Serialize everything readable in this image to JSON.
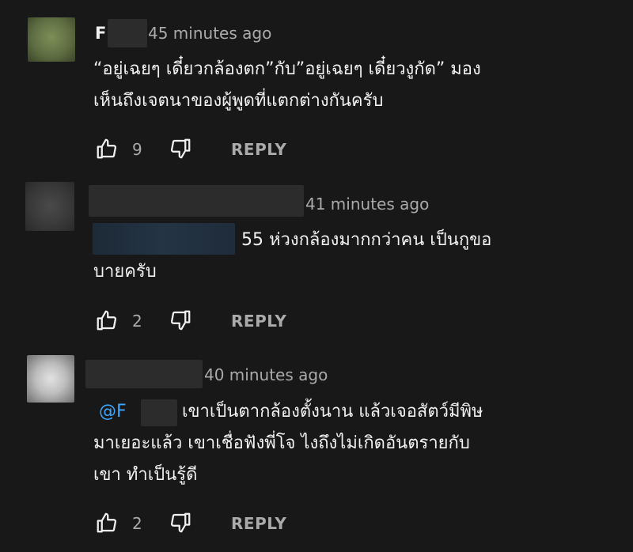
{
  "comments": [
    {
      "author": "F",
      "time": "45 minutes ago",
      "lines": [
        "“อยู่เฉยๆ เดี๋ยวกล้องตก”กับ”อยู่เฉยๆ เดี๋ยวงูกัด” มอง",
        "เห็นถึงเจตนาของผู้พูดที่แตกต่างกันครับ"
      ],
      "likes": "9",
      "reply_label": "REPLY"
    },
    {
      "author": "",
      "time": "41 minutes ago",
      "lines": [
        "55 ห่วงกล้องมากกว่าคน เป็นกูขอ",
        "บายครับ"
      ],
      "likes": "2",
      "reply_label": "REPLY"
    },
    {
      "author": "",
      "time": "40 minutes ago",
      "mention": "@F",
      "lines": [
        "เขาเป็นตากล้องตั้งนาน แล้วเจอสัตว์มีพิษ",
        "มาเยอะแล้ว เขาเชื่อฟังพี่โจ ไงถึงไม่เกิดอันตรายกับ",
        "เขา ทำเป็นรู้ดี"
      ],
      "likes": "2",
      "reply_label": "REPLY"
    }
  ],
  "icons": {
    "like": "thumbs-up-icon",
    "dislike": "thumbs-down-icon"
  }
}
